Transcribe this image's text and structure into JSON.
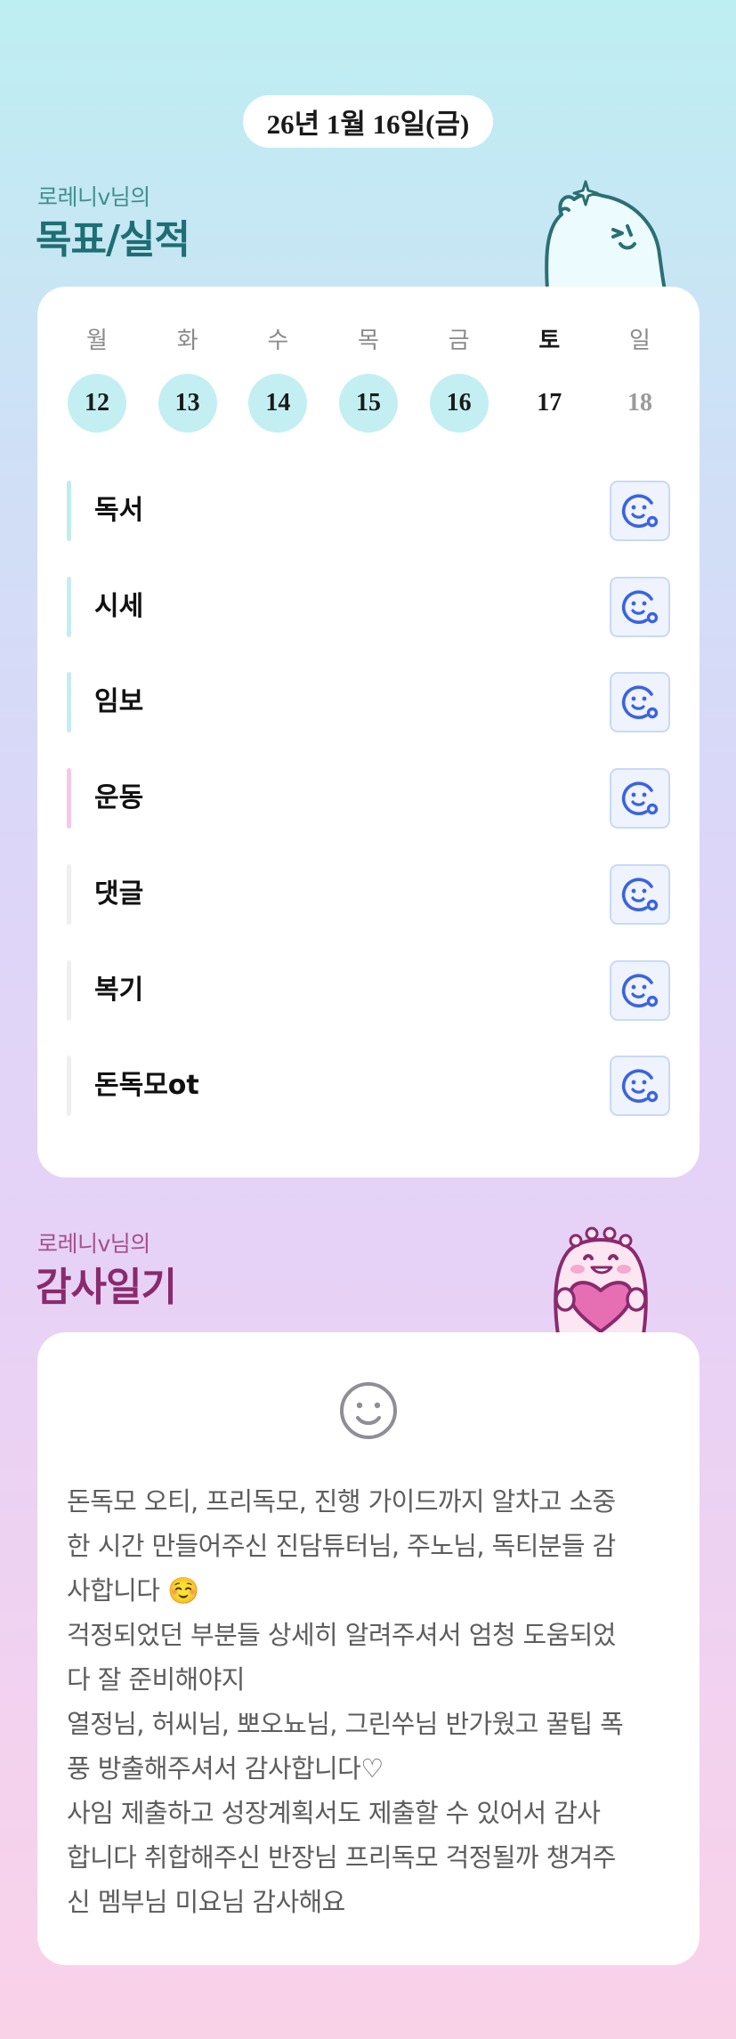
{
  "date_label": "26년 1월 16일(금)",
  "goals_section": {
    "user_label": "로레니v님의",
    "title": "목표/실적"
  },
  "week": {
    "days": [
      {
        "name": "월",
        "num": "12",
        "state": "done"
      },
      {
        "name": "화",
        "num": "13",
        "state": "done"
      },
      {
        "name": "수",
        "num": "14",
        "state": "done"
      },
      {
        "name": "목",
        "num": "15",
        "state": "done"
      },
      {
        "name": "금",
        "num": "16",
        "state": "done"
      },
      {
        "name": "토",
        "num": "17",
        "state": "today"
      },
      {
        "name": "일",
        "num": "18",
        "state": "future"
      }
    ]
  },
  "goals": [
    {
      "name": "독서",
      "bar_color": "#bfeee8"
    },
    {
      "name": "시세",
      "bar_color": "#c5ecf4"
    },
    {
      "name": "임보",
      "bar_color": "#c5ecf4"
    },
    {
      "name": "운동",
      "bar_color": "#f6c8e6"
    },
    {
      "name": "댓글",
      "bar_color": "#efefef"
    },
    {
      "name": "복기",
      "bar_color": "#efefef"
    },
    {
      "name": "돈독모ot",
      "bar_color": "#efefef"
    }
  ],
  "gratitude_section": {
    "user_label": "로레니v님의",
    "title": "감사일기",
    "text": "돈독모 오티, 프리독모, 진행 가이드까지 알차고 소중\n한 시간 만들어주신 진담튜터님, 주노님, 독티분들 감\n사합니다 ☺️\n걱정되었던 부분들 상세히 알려주셔서 엄청 도움되었\n다 잘 준비해야지\n열정님, 허씨님, 뽀오뇨님, 그린쑤님 반가웠고 꿀팁 폭\n풍 방출해주셔서 감사합니다♡\n사임 제출하고 성장계획서도 제출할 수 있어서 감사\n합니다 취합해주신 반장님 프리독모 걱정될까 챙겨주\n신 멤부님 미요님 감사해요"
  },
  "colors": {
    "accent_blue": "#3b63e0",
    "teal_title": "#1c6f73",
    "pink_title": "#8a2a6e",
    "done_circle": "#c3eff2"
  },
  "icons": {
    "goal_action": "smiley-plus-icon",
    "diary_mood": "smiley-face-icon",
    "mascot_top": "ghost-mascot",
    "mascot_bottom": "heart-mascot"
  }
}
